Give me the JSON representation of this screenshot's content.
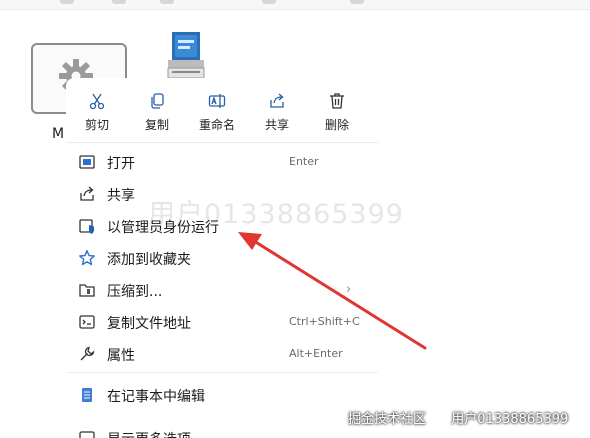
{
  "file_tile": {
    "label": "M",
    "icon": "gear-icon"
  },
  "app_icon": {
    "icon": "installer-package-icon"
  },
  "toolbar": [
    {
      "icon": "scissors-icon",
      "label": "剪切"
    },
    {
      "icon": "copy-icon",
      "label": "复制"
    },
    {
      "icon": "rename-icon",
      "label": "重命名"
    },
    {
      "icon": "share-icon",
      "label": "共享"
    },
    {
      "icon": "trash-icon",
      "label": "删除"
    }
  ],
  "menu_items": [
    {
      "icon": "open-window-icon",
      "label": "打开",
      "shortcut": "Enter"
    },
    {
      "icon": "share-icon",
      "label": "共享",
      "shortcut": ""
    },
    {
      "icon": "admin-shield-icon",
      "label": "以管理员身份运行",
      "shortcut": ""
    },
    {
      "icon": "star-icon",
      "label": "添加到收藏夹",
      "shortcut": ""
    },
    {
      "icon": "compressed-folder-icon",
      "label": "压缩到...",
      "shortcut": "",
      "chevron": "›"
    },
    {
      "icon": "copy-path-icon",
      "label": "复制文件地址",
      "shortcut": "Ctrl+Shift+C"
    },
    {
      "icon": "wrench-icon",
      "label": "属性",
      "shortcut": "Alt+Enter"
    },
    {
      "icon": "notepad-icon",
      "label": "在记事本中编辑",
      "shortcut": ""
    },
    {
      "icon": "more-options-icon",
      "label": "显示更多选项",
      "shortcut": ""
    }
  ],
  "watermark": "用户01338865399",
  "footer_watermark": {
    "prefix": "掘金技术社区",
    "at": "@",
    "user": "用户01338865399"
  },
  "colors": {
    "arrow": "#e03530",
    "accent": "#0067c0",
    "star": "#2c6fd1"
  }
}
